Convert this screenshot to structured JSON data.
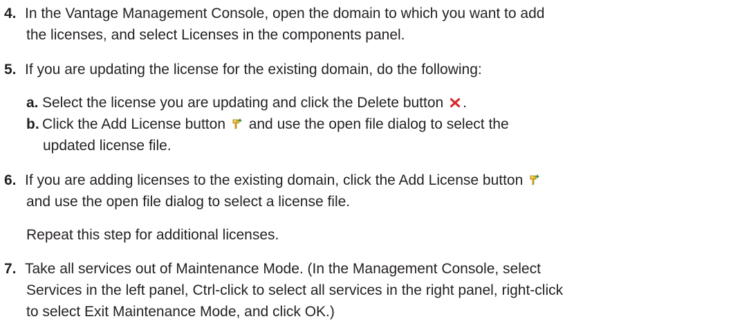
{
  "steps": {
    "s4": {
      "number": "4.",
      "line1": "In the Vantage Management Console, open the domain to which you want to add",
      "line2": "the licenses, and select Licenses in the components panel."
    },
    "s5": {
      "number": "5.",
      "line1": "If you are updating the license for the existing domain, do the following:",
      "a": {
        "letter": "a.",
        "text_before_icon": "Select the license you are updating and click the Delete button",
        "text_after_icon": ".",
        "icon": "delete-x-icon"
      },
      "b": {
        "letter": "b.",
        "text_before_icon": "Click the Add License button",
        "text_after_icon": "and use the open file dialog to select the",
        "line2": "updated license file.",
        "icon": "add-license-icon"
      }
    },
    "s6": {
      "number": "6.",
      "text_before_icon": "If you are adding licenses to the existing domain, click the Add License button",
      "icon": "add-license-icon",
      "line2": "and use the open file dialog to select a license file.",
      "note": "Repeat this step for additional licenses."
    },
    "s7": {
      "number": "7.",
      "line1": "Take all services out of Maintenance Mode. (In the Management Console, select",
      "line2": "Services in the left panel, Ctrl-click to select all services in the right panel, right-click",
      "line3": "to select Exit Maintenance Mode, and click OK.)"
    }
  },
  "colors": {
    "text": "#231f20",
    "delete_icon": "#d7262b",
    "license_icon": "#e0b41c"
  }
}
